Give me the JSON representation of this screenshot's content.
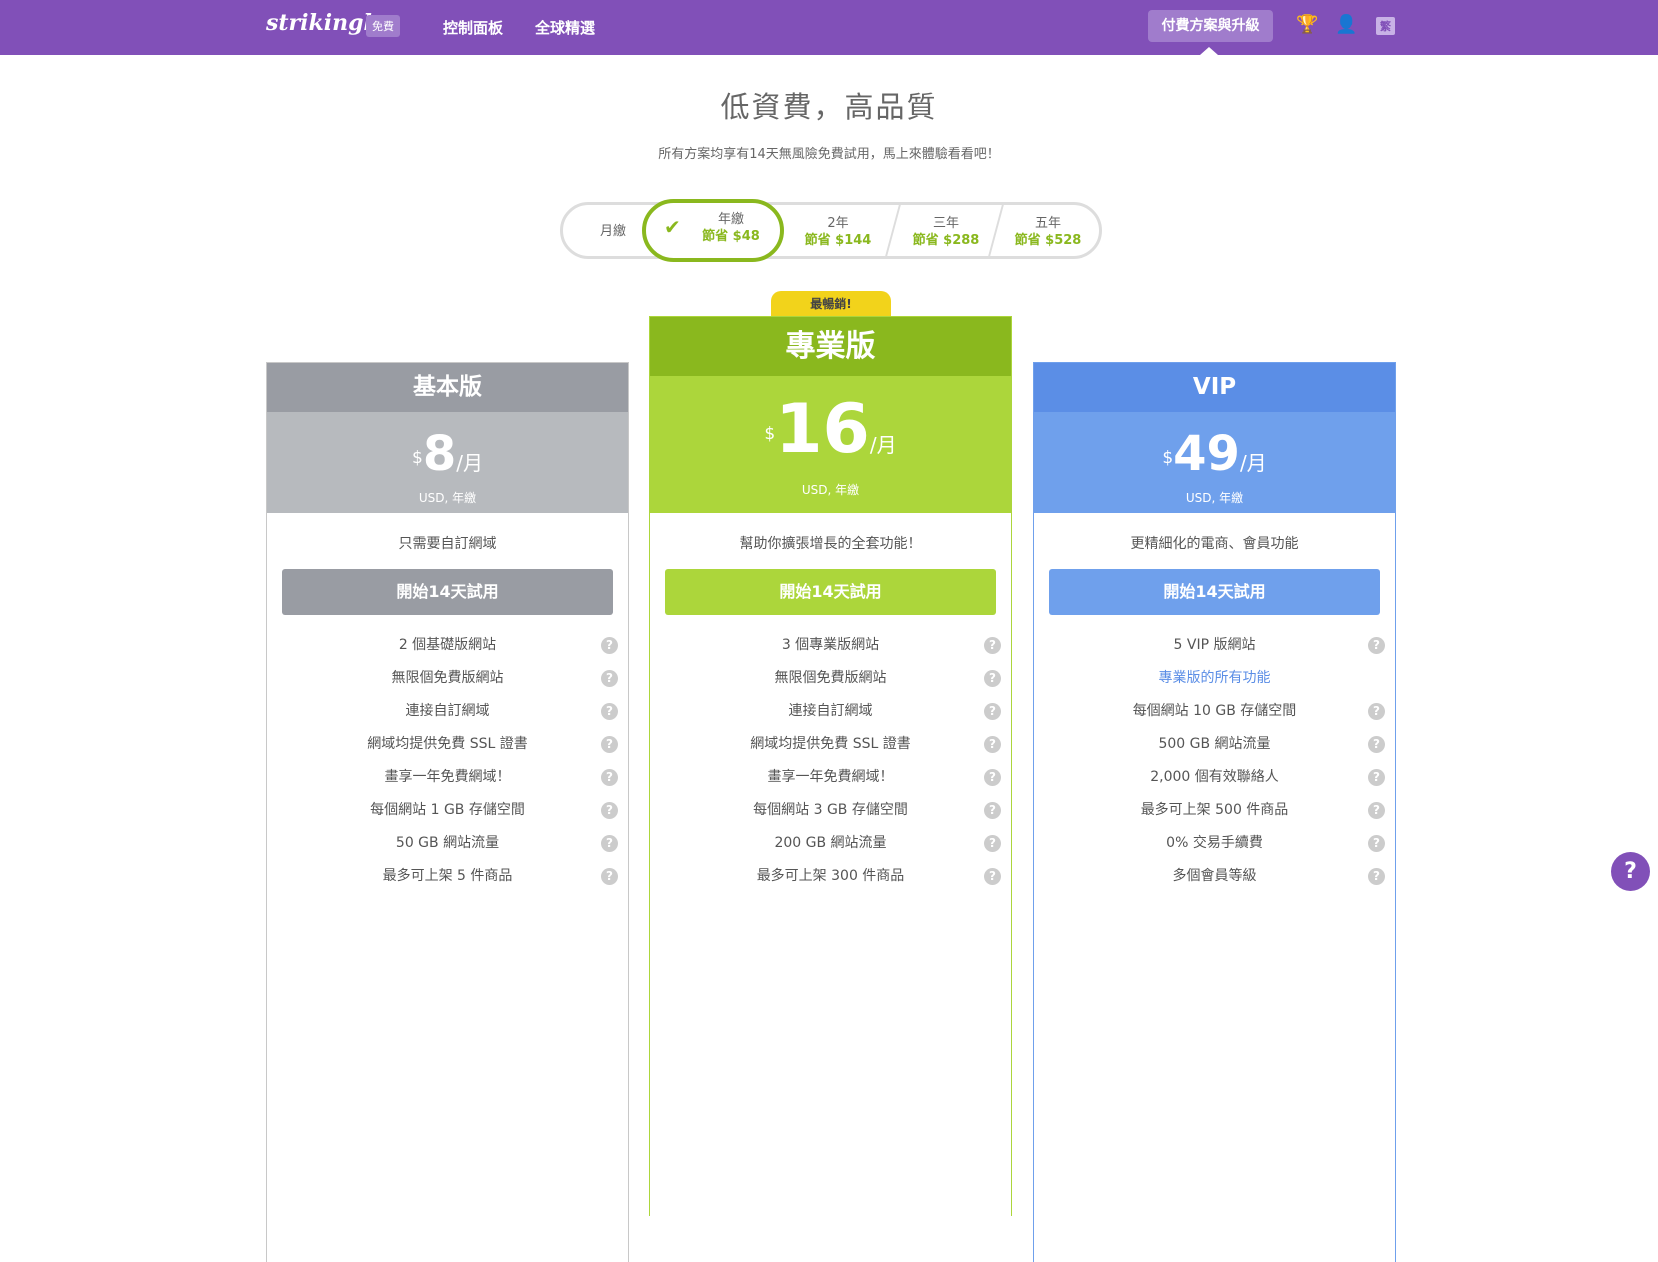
{
  "nav": {
    "logo": "strikingly",
    "plan_badge": "免費",
    "links": [
      "控制面板",
      "全球精選"
    ],
    "upgrade": "付費方案與升級",
    "lang": "繁"
  },
  "header": {
    "title": "低資費，高品質",
    "subtitle": "所有方案均享有14天無風險免費試用，馬上來體驗看看吧！"
  },
  "billing": {
    "options": [
      {
        "label": "月繳",
        "save": ""
      },
      {
        "label": "年繳",
        "save": "節省 $48"
      },
      {
        "label": "2年",
        "save": "節省 $144"
      },
      {
        "label": "三年",
        "save": "節省 $288"
      },
      {
        "label": "五年",
        "save": "節省 $528"
      }
    ],
    "selected": "年繳"
  },
  "badge": "最暢銷!",
  "plans": [
    {
      "name": "基本版",
      "currency": "$",
      "price": "8",
      "per": "/月",
      "billing": "USD, 年繳",
      "desc": "只需要自訂網域",
      "cta": "開始14天試用",
      "colors": {
        "head": "#999ca3",
        "price": "#b7babe",
        "border": "#c8c8c8"
      },
      "features": [
        "2 個基礎版網站",
        "無限個免費版網站",
        "連接自訂網域",
        "網域均提供免費 SSL 證書",
        "畫享一年免費網域！",
        "每個網站 1 GB 存儲空間",
        "50 GB 網站流量",
        "最多可上架 5 件商品"
      ]
    },
    {
      "name": "專業版",
      "currency": "$",
      "price": "16",
      "per": "/月",
      "billing": "USD, 年繳",
      "desc": "幫助你擴張增長的全套功能！",
      "cta": "開始14天試用",
      "colors": {
        "head": "#8ab81e",
        "price": "#acd63b",
        "border": "#acd63b"
      },
      "features": [
        "3 個專業版網站",
        "無限個免費版網站",
        "連接自訂網域",
        "網域均提供免費 SSL 證書",
        "畫享一年免費網域！",
        "每個網站 3 GB 存儲空間",
        "200 GB 網站流量",
        "最多可上架 300 件商品"
      ]
    },
    {
      "name": "VIP",
      "currency": "$",
      "price": "49",
      "per": "/月",
      "billing": "USD, 年繳",
      "desc": "更精細化的電商、會員功能",
      "cta": "開始14天試用",
      "colors": {
        "head": "#5b8ee6",
        "price": "#6fa0ec",
        "border": "#6fa0ec"
      },
      "features": [
        "5 VIP 版網站",
        "專業版的所有功能",
        "每個網站 10 GB 存儲空間",
        "500 GB 網站流量",
        "2,000 個有效聯絡人",
        "最多可上架 500 件商品",
        "0% 交易手續費",
        "多個會員等級"
      ]
    }
  ],
  "help": "?"
}
